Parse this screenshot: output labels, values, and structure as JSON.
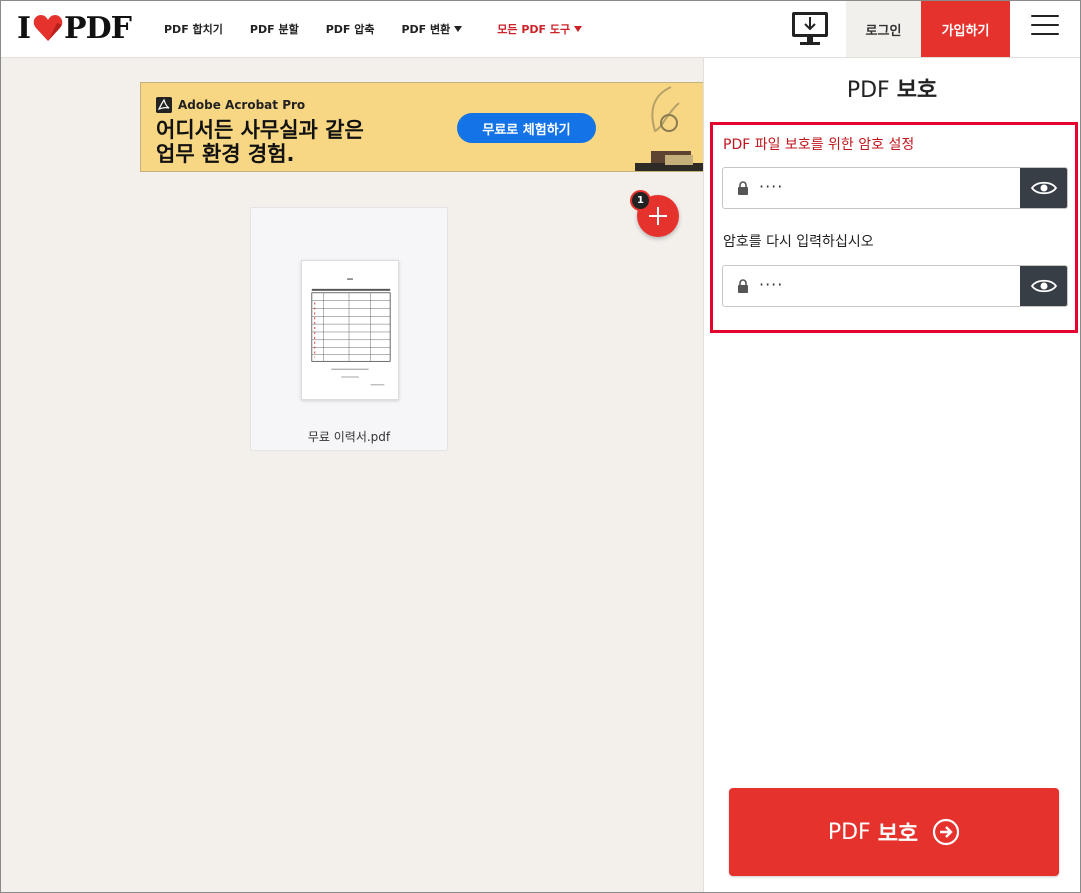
{
  "header": {
    "logo_left": "I",
    "logo_right": "PDF",
    "nav": [
      {
        "label": "PDF 합치기",
        "has_dropdown": false
      },
      {
        "label": "PDF 분할",
        "has_dropdown": false
      },
      {
        "label": "PDF 압축",
        "has_dropdown": false
      },
      {
        "label": "PDF 변환",
        "has_dropdown": true
      },
      {
        "label": "모든 PDF 도구",
        "has_dropdown": true
      }
    ],
    "login_label": "로그인",
    "signup_label": "가입하기",
    "desktop_icon": "desktop-download-icon",
    "menu_icon": "hamburger-menu-icon"
  },
  "ad": {
    "brand": "Adobe Acrobat Pro",
    "headline_line1": "어디서든 사무실과 같은",
    "headline_line2": "업무 환경 경험.",
    "cta": "무료로 체험하기"
  },
  "workspace": {
    "file_name": "무료 이력서.pdf",
    "file_count": "1"
  },
  "sidebar": {
    "title_prefix": "PDF",
    "title_bold": "보호",
    "password_label": "PDF 파일 보호를 위한 암호 설정",
    "password_value": "····",
    "confirm_label": "암호를 다시 입력하십시오",
    "confirm_value": "····",
    "submit_prefix": "PDF",
    "submit_bold": "보호"
  },
  "colors": {
    "brand_red": "#e5322d",
    "highlight_border": "#e4032e",
    "label_red": "#c0161c",
    "eye_button": "#383e45",
    "ad_yellow": "#f7d783",
    "ad_cta_blue": "#1473e6"
  }
}
